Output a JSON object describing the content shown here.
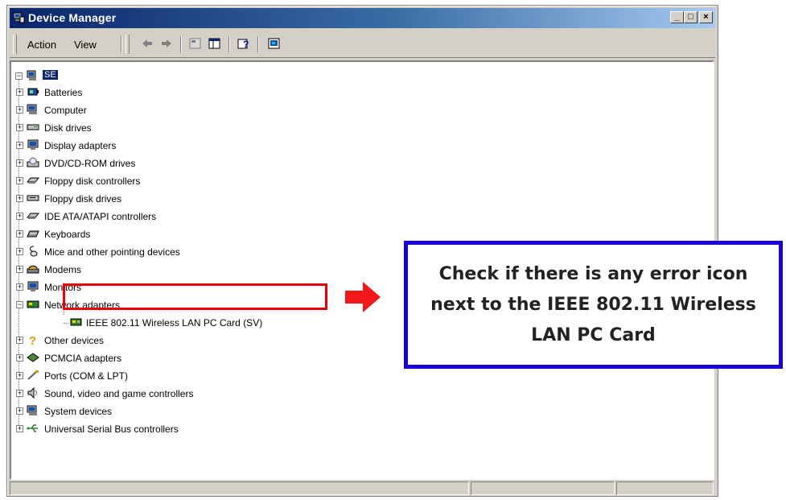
{
  "window": {
    "title": "Device Manager",
    "controls": [
      "_",
      "□",
      "×"
    ]
  },
  "menubar": {
    "items": [
      {
        "label": "Action"
      },
      {
        "label": "View"
      }
    ],
    "toolbar_icons": [
      "back-arrow-icon",
      "forward-arrow-icon",
      "properties-icon",
      "show-hide-console-tree-icon",
      "help-icon",
      "scan-hardware-icon"
    ]
  },
  "tree": {
    "root": {
      "label": "SE",
      "icon": "computer-icon"
    },
    "categories": [
      {
        "label": "Batteries",
        "icon": "battery-icon"
      },
      {
        "label": "Computer",
        "icon": "computer-icon"
      },
      {
        "label": "Disk drives",
        "icon": "disk-drive-icon"
      },
      {
        "label": "Display adapters",
        "icon": "monitor-icon"
      },
      {
        "label": "DVD/CD-ROM drives",
        "icon": "cdrom-icon"
      },
      {
        "label": "Floppy disk controllers",
        "icon": "controller-icon"
      },
      {
        "label": "Floppy disk drives",
        "icon": "floppy-icon"
      },
      {
        "label": "IDE ATA/ATAPI controllers",
        "icon": "controller-icon"
      },
      {
        "label": "Keyboards",
        "icon": "keyboard-icon"
      },
      {
        "label": "Mice and other pointing devices",
        "icon": "mouse-icon"
      },
      {
        "label": "Modems",
        "icon": "modem-icon"
      },
      {
        "label": "Monitors",
        "icon": "monitor-icon"
      },
      {
        "label": "Network adapters",
        "icon": "network-icon",
        "expanded": true,
        "children": [
          {
            "label": "IEEE 802.11 Wireless LAN PC Card (SV)",
            "icon": "network-card-icon"
          }
        ]
      },
      {
        "label": "Other devices",
        "icon": "question-icon"
      },
      {
        "label": "PCMCIA adapters",
        "icon": "pcmcia-icon"
      },
      {
        "label": "Ports (COM & LPT)",
        "icon": "port-icon"
      },
      {
        "label": "Sound, video and game controllers",
        "icon": "speaker-icon"
      },
      {
        "label": "System devices",
        "icon": "computer-icon"
      },
      {
        "label": "Universal Serial Bus controllers",
        "icon": "usb-icon"
      }
    ]
  },
  "annotation": {
    "callout_text": "Check if there is any error icon next to the IEEE 802.11 Wireless LAN PC Card",
    "highlight_color": "#e8000b",
    "callout_border_color": "#1900d6"
  }
}
